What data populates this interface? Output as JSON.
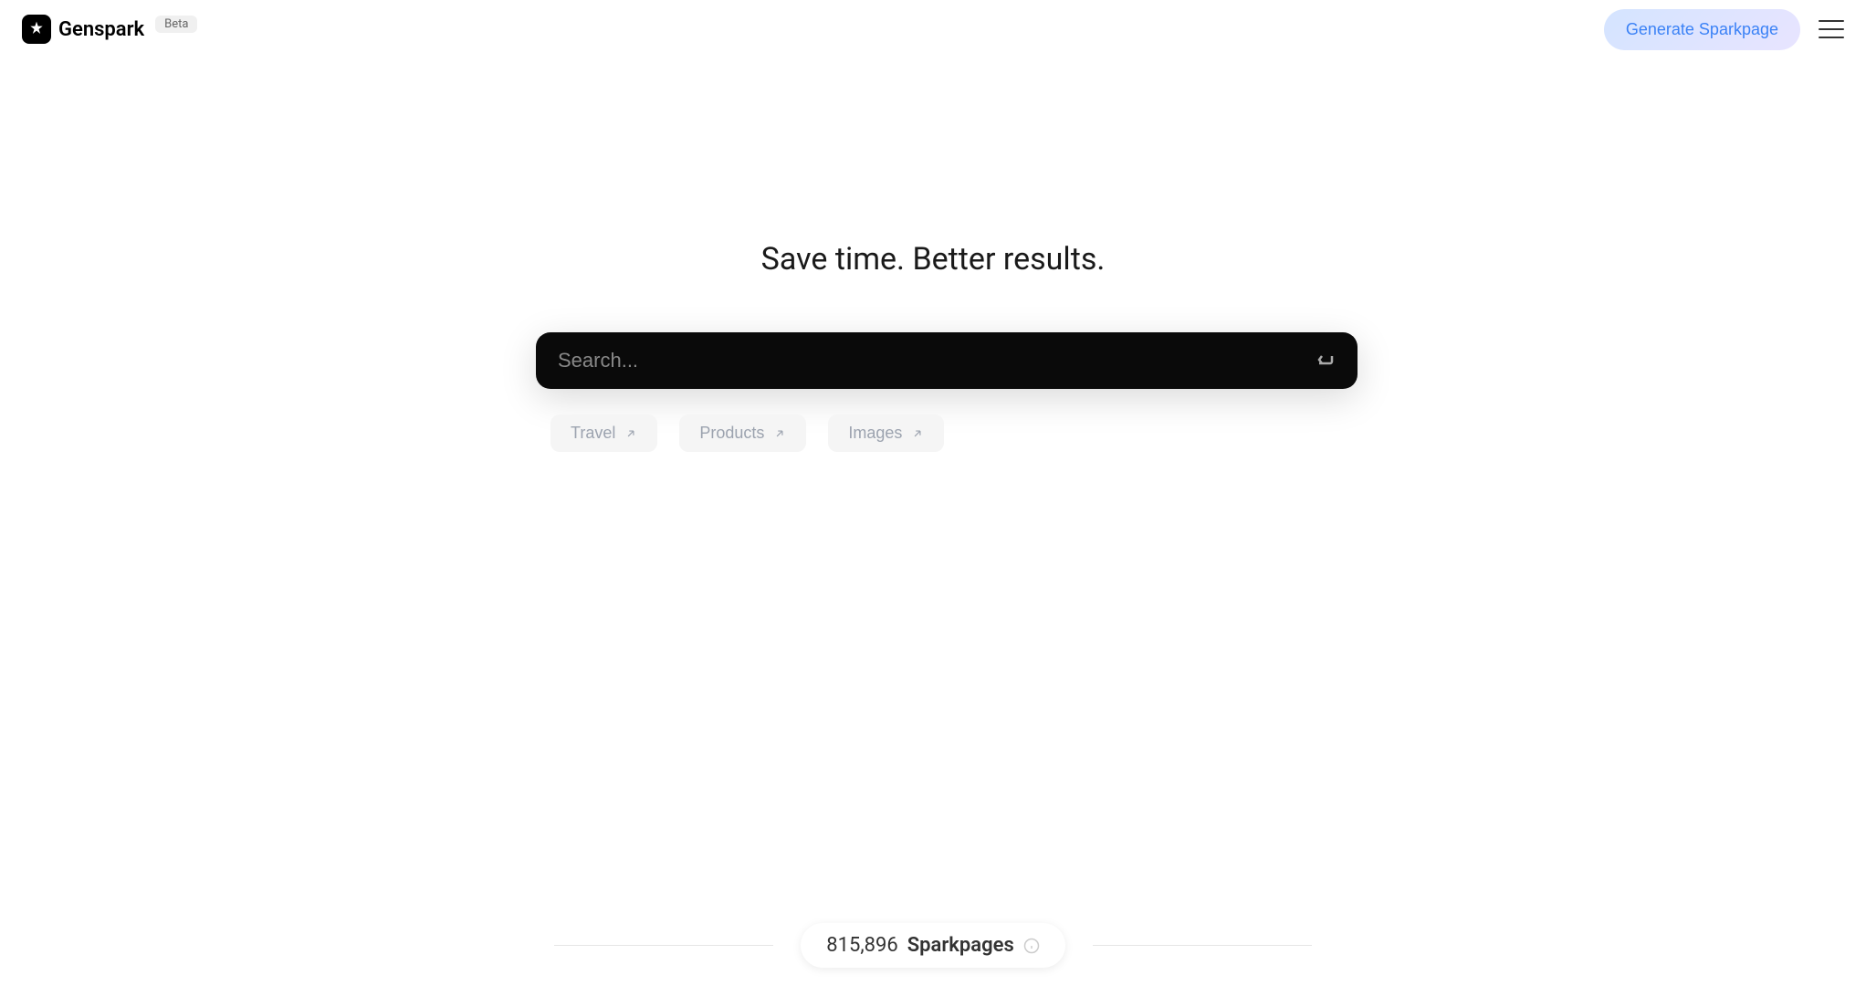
{
  "header": {
    "logo_text": "Genspark",
    "beta_label": "Beta",
    "generate_button_label": "Generate Sparkpage"
  },
  "main": {
    "tagline": "Save time. Better results.",
    "search_placeholder": "Search...",
    "categories": [
      {
        "label": "Travel"
      },
      {
        "label": "Products"
      },
      {
        "label": "Images"
      }
    ]
  },
  "footer": {
    "sparkpages_count": "815,896",
    "sparkpages_label": "Sparkpages"
  }
}
